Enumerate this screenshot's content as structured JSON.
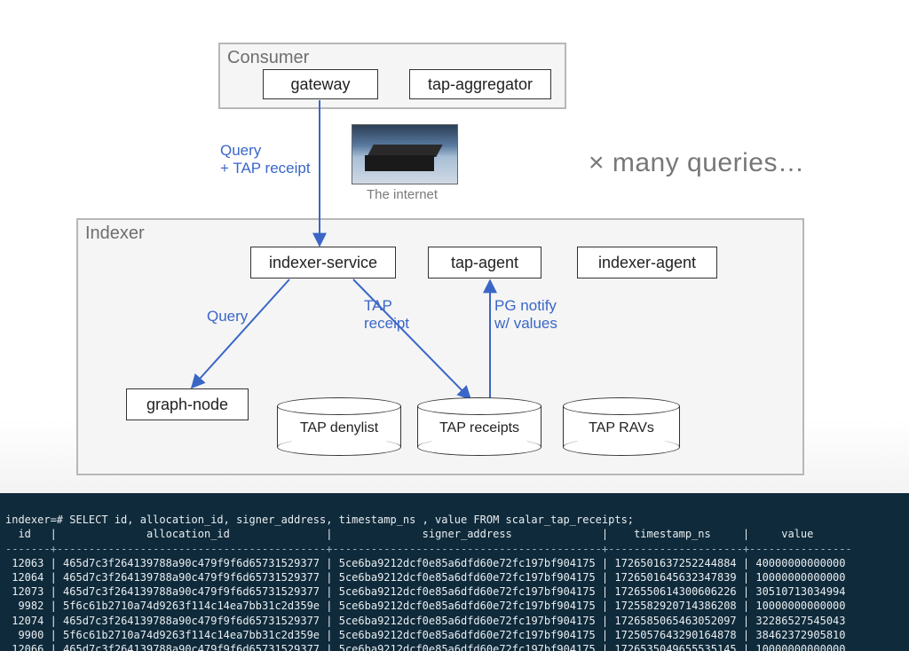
{
  "diagram": {
    "consumer": {
      "title": "Consumer",
      "gateway": "gateway",
      "tap_aggregator": "tap-aggregator"
    },
    "internet_caption": "The internet",
    "query_tap_receipt": "Query\n+ TAP receipt",
    "many_queries": "× many queries…",
    "indexer": {
      "title": "Indexer",
      "indexer_service": "indexer-service",
      "tap_agent": "tap-agent",
      "indexer_agent": "indexer-agent",
      "graph_node": "graph-node",
      "tap_denylist": "TAP denylist",
      "tap_receipts": "TAP receipts",
      "tap_ravs": "TAP RAVs",
      "lbl_query": "Query",
      "lbl_tap_receipt": "TAP\nreceipt",
      "lbl_pg_notify": "PG notify\nw/ values"
    }
  },
  "terminal": {
    "prompt": "indexer=# SELECT id, allocation_id, signer_address, timestamp_ns , value FROM scalar_tap_receipts;",
    "columns": [
      "id",
      "allocation_id",
      "signer_address",
      "timestamp_ns",
      "value"
    ],
    "rows": [
      {
        "id": "12063",
        "allocation_id": "465d7c3f264139788a90c479f9f6d65731529377",
        "signer_address": "5ce6ba9212dcf0e85a6dfd60e72fc197bf904175",
        "timestamp_ns": "1726501637252244884",
        "value": "40000000000000"
      },
      {
        "id": "12064",
        "allocation_id": "465d7c3f264139788a90c479f9f6d65731529377",
        "signer_address": "5ce6ba9212dcf0e85a6dfd60e72fc197bf904175",
        "timestamp_ns": "1726501645632347839",
        "value": "10000000000000"
      },
      {
        "id": "12073",
        "allocation_id": "465d7c3f264139788a90c479f9f6d65731529377",
        "signer_address": "5ce6ba9212dcf0e85a6dfd60e72fc197bf904175",
        "timestamp_ns": "1726550614300606226",
        "value": "30510713034994"
      },
      {
        "id": "9982",
        "allocation_id": "5f6c61b2710a74d9263f114c14ea7bb31c2d359e",
        "signer_address": "5ce6ba9212dcf0e85a6dfd60e72fc197bf904175",
        "timestamp_ns": "1725582920714386208",
        "value": "10000000000000"
      },
      {
        "id": "12074",
        "allocation_id": "465d7c3f264139788a90c479f9f6d65731529377",
        "signer_address": "5ce6ba9212dcf0e85a6dfd60e72fc197bf904175",
        "timestamp_ns": "1726585065463052097",
        "value": "32286527545043"
      },
      {
        "id": "9900",
        "allocation_id": "5f6c61b2710a74d9263f114c14ea7bb31c2d359e",
        "signer_address": "5ce6ba9212dcf0e85a6dfd60e72fc197bf904175",
        "timestamp_ns": "1725057643290164878",
        "value": "38462372905810"
      },
      {
        "id": "12066",
        "allocation_id": "465d7c3f264139788a90c479f9f6d65731529377",
        "signer_address": "5ce6ba9212dcf0e85a6dfd60e72fc197bf904175",
        "timestamp_ns": "1726535049655535145",
        "value": "10000000000000"
      }
    ]
  }
}
